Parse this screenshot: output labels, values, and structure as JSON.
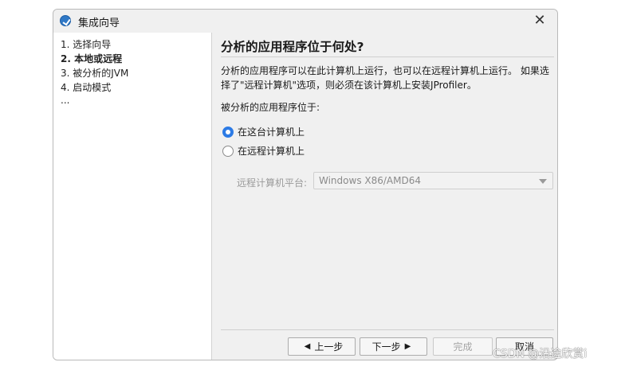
{
  "window": {
    "title": "集成向导",
    "app_icon": "app-logo-icon",
    "close_glyph": "✕"
  },
  "nav": {
    "items": [
      {
        "label": "1. 选择向导",
        "active": false
      },
      {
        "label": "2. 本地或远程",
        "active": true
      },
      {
        "label": "3. 被分析的JVM",
        "active": false
      },
      {
        "label": "4. 启动模式",
        "active": false
      },
      {
        "label": "...",
        "active": false
      }
    ]
  },
  "main": {
    "heading": "分析的应用程序位于何处?",
    "description": "分析的应用程序可以在此计算机上运行，也可以在远程计算机上运行。 如果选择了\"远程计算机\"选项，则必须在该计算机上安装JProfiler。",
    "question": "被分析的应用程序位于:",
    "options": [
      {
        "label": "在这台计算机上",
        "checked": true
      },
      {
        "label": "在远程计算机上",
        "checked": false
      }
    ],
    "platform": {
      "label": "远程计算机平台:",
      "value": "Windows X86/AMD64",
      "enabled": false
    }
  },
  "buttons": {
    "back": "上一步",
    "next": "下一步",
    "finish": "完成",
    "cancel": "取消",
    "finish_enabled": false
  },
  "watermark": "CSDN @沿途欣赏i",
  "colors": {
    "accent": "#2d7be5",
    "dialog_bg": "#f0f0f0",
    "nav_bg": "#ffffff"
  }
}
